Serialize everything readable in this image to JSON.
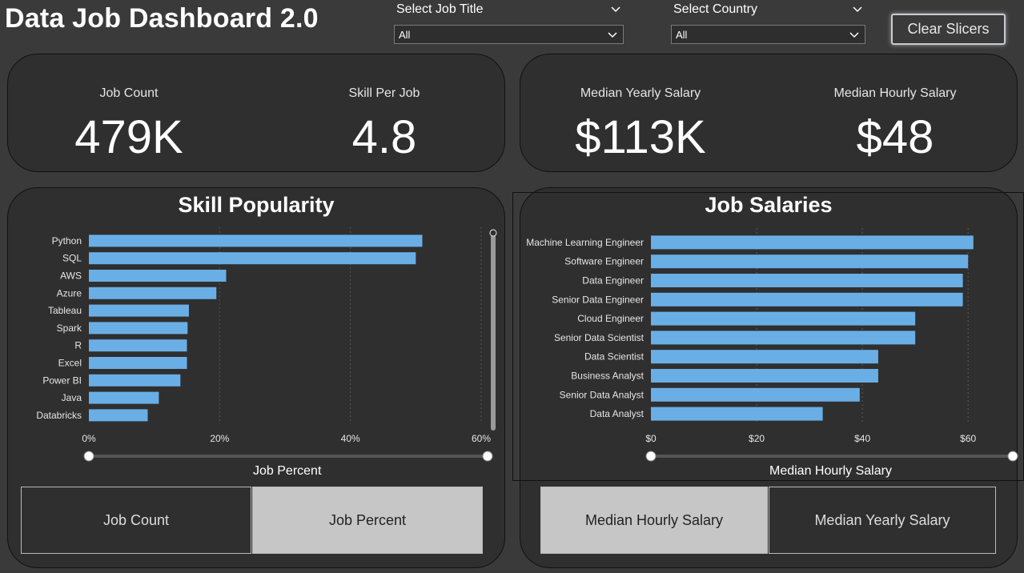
{
  "header": {
    "title": "Data Job Dashboard 2.0"
  },
  "slicers": {
    "job_title": {
      "label": "Select Job Title",
      "value": "All"
    },
    "country": {
      "label": "Select Country",
      "value": "All"
    },
    "clear_label": "Clear Slicers"
  },
  "kpis": {
    "job_count": {
      "label": "Job Count",
      "value": "479K"
    },
    "skill_per_job": {
      "label": "Skill Per Job",
      "value": "4.8"
    },
    "median_yearly": {
      "label": "Median Yearly Salary",
      "value": "$113K"
    },
    "median_hourly": {
      "label": "Median Hourly Salary",
      "value": "$48"
    }
  },
  "skill_panel": {
    "title": "Skill Popularity",
    "buttons": {
      "job_count": "Job Count",
      "job_percent": "Job Percent"
    },
    "active_button": "Job Percent"
  },
  "salary_panel": {
    "title": "Job Salaries",
    "buttons": {
      "hourly": "Median Hourly Salary",
      "yearly": "Median Yearly Salary"
    },
    "active_button": "Median Hourly Salary"
  },
  "colors": {
    "bar": "#6aaee6",
    "background": "#3a3a3a",
    "card": "#2f2f2f",
    "grid": "#5a5a5a"
  },
  "chart_data": [
    {
      "type": "bar",
      "orientation": "horizontal",
      "title": "Skill Popularity",
      "xlabel": "Job Percent",
      "categories": [
        "Python",
        "SQL",
        "AWS",
        "Azure",
        "Tableau",
        "Spark",
        "R",
        "Excel",
        "Power BI",
        "Java",
        "Databricks"
      ],
      "values": [
        51,
        50,
        21,
        19.5,
        15.3,
        15.1,
        15,
        15,
        14,
        10.7,
        9
      ],
      "xlim": [
        0,
        60
      ],
      "xticks": [
        "0%",
        "20%",
        "40%",
        "60%"
      ],
      "xtick_values": [
        0,
        20,
        40,
        60
      ],
      "grid": true
    },
    {
      "type": "bar",
      "orientation": "horizontal",
      "title": "Job Salaries",
      "xlabel": "Median Hourly Salary",
      "categories": [
        "Machine Learning Engineer",
        "Software Engineer",
        "Data Engineer",
        "Senior Data Engineer",
        "Cloud Engineer",
        "Senior Data Scientist",
        "Data Scientist",
        "Business Analyst",
        "Senior Data Analyst",
        "Data Analyst"
      ],
      "values": [
        61,
        60,
        59,
        59,
        50,
        50,
        43,
        43,
        39.5,
        32.5
      ],
      "xlim": [
        0,
        68
      ],
      "xticks": [
        "$0",
        "$20",
        "$40",
        "$60"
      ],
      "xtick_values": [
        0,
        20,
        40,
        60
      ],
      "grid": true
    }
  ]
}
